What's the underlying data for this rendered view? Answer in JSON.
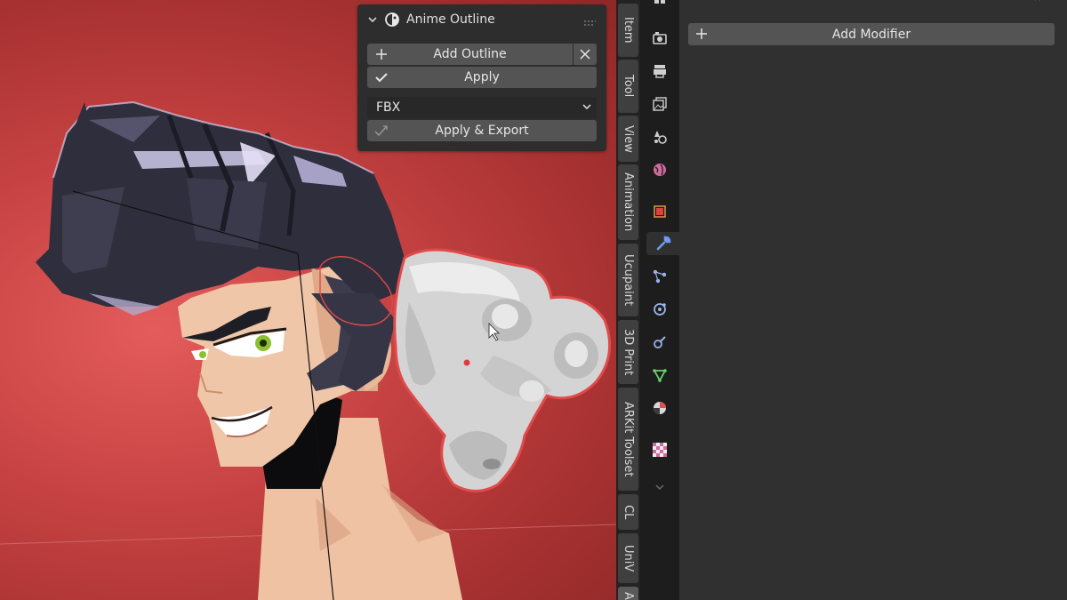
{
  "viewport": {
    "panel": {
      "title": "Anime Outline",
      "add_outline_label": "Add Outline",
      "apply_label": "Apply",
      "format_selected": "FBX",
      "apply_export_label": "Apply & Export"
    },
    "tabs": [
      "Item",
      "Tool",
      "View",
      "Animation",
      "Ucupaint",
      "3D Print",
      "ARKit Toolset",
      "CL",
      "UniV",
      "A"
    ]
  },
  "properties": {
    "icons": [
      "tool-icon",
      "render-icon",
      "output-icon",
      "view-layer-icon",
      "scene-icon",
      "world-icon",
      "object-icon",
      "modifier-icon",
      "particles-icon",
      "physics-icon",
      "constraints-icon",
      "data-icon",
      "material-icon",
      "texture-icon",
      "more-chevron-icon"
    ],
    "active_icon": "modifier-icon",
    "add_modifier_label": "Add Modifier"
  },
  "colors": {
    "background_red": "#c94444",
    "accent_blue": "#4772b3",
    "outline_red": "#e05050"
  }
}
